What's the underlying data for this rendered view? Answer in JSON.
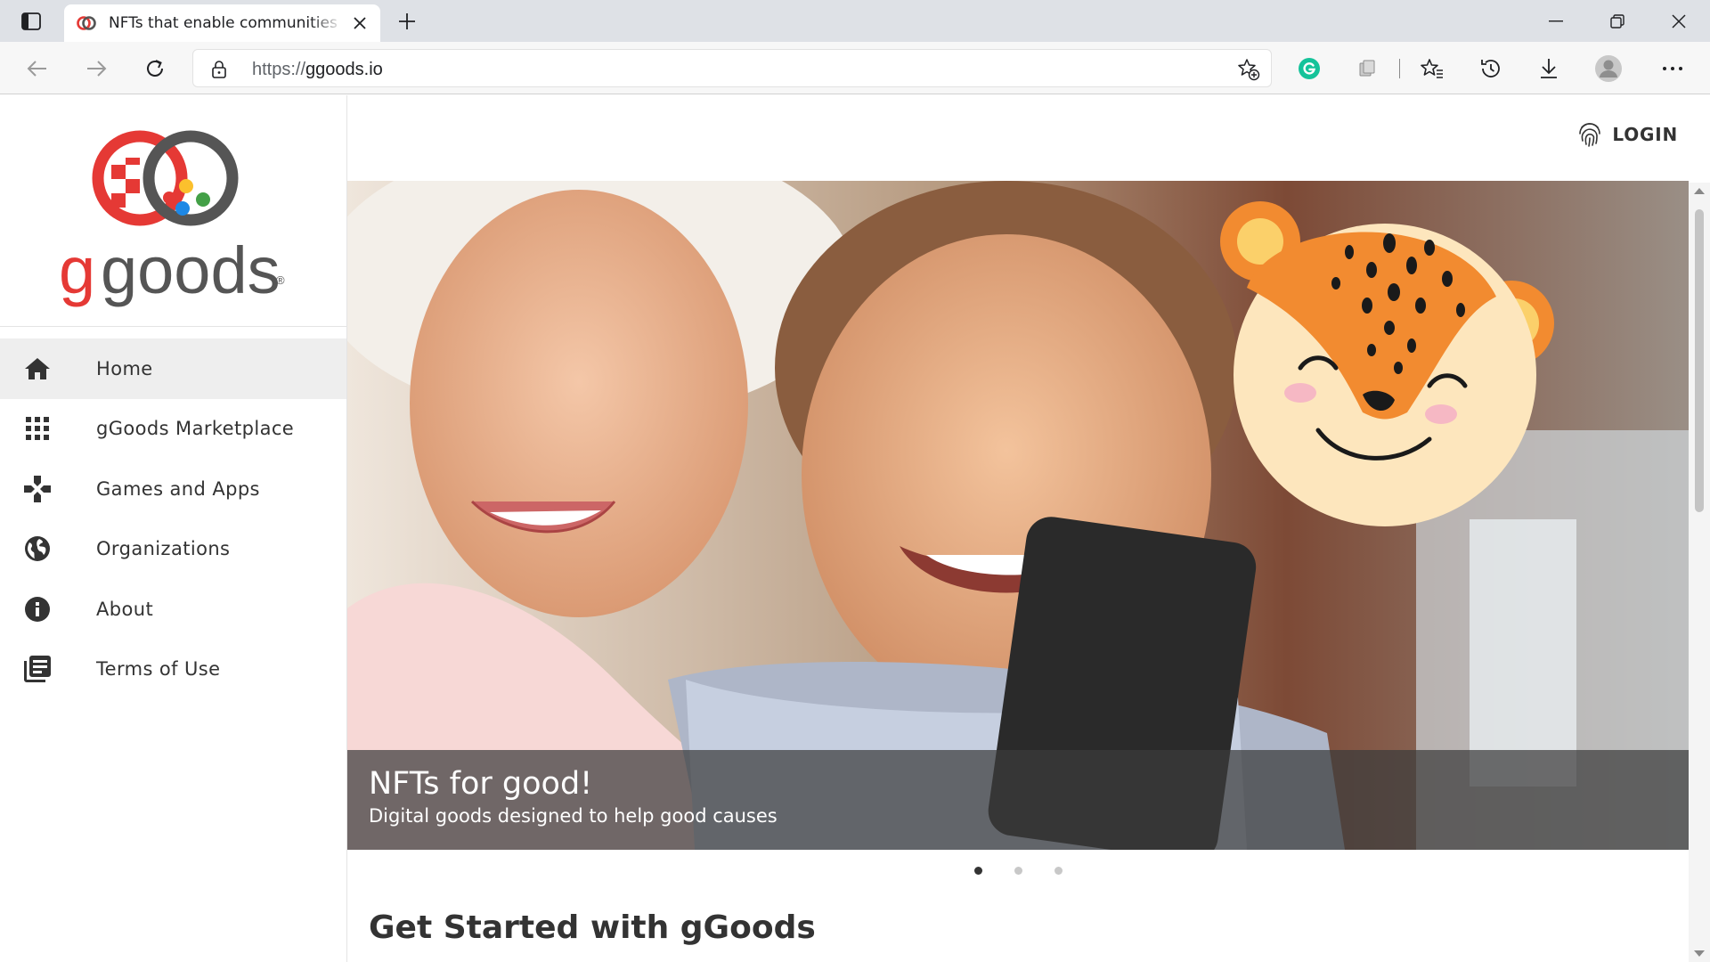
{
  "browser": {
    "tab_title": "NFTs that enable communities to",
    "url_scheme": "https://",
    "url_host": "ggoods.io"
  },
  "logo": {
    "wordmark": "ggoods",
    "registered_mark": "®"
  },
  "sidebar": {
    "items": [
      {
        "label": "Home",
        "icon": "home-icon",
        "active": true
      },
      {
        "label": "gGoods Marketplace",
        "icon": "grid-icon",
        "active": false
      },
      {
        "label": "Games and Apps",
        "icon": "gamepad-icon",
        "active": false
      },
      {
        "label": "Organizations",
        "icon": "globe-icon",
        "active": false
      },
      {
        "label": "About",
        "icon": "info-icon",
        "active": false
      },
      {
        "label": "Terms of Use",
        "icon": "document-icon",
        "active": false
      }
    ]
  },
  "header": {
    "login_label": "LOGIN",
    "login_icon": "fingerprint-icon"
  },
  "hero": {
    "title": "NFTs for good!",
    "subtitle": "Digital goods designed to help good causes",
    "slide_count": 3,
    "active_slide": 1
  },
  "main": {
    "section_title": "Get Started with gGoods"
  },
  "colors": {
    "brand_red": "#e53935",
    "brand_gray": "#555555",
    "caption_bg": "#3c3c3c",
    "accent_green": "#21a366"
  }
}
